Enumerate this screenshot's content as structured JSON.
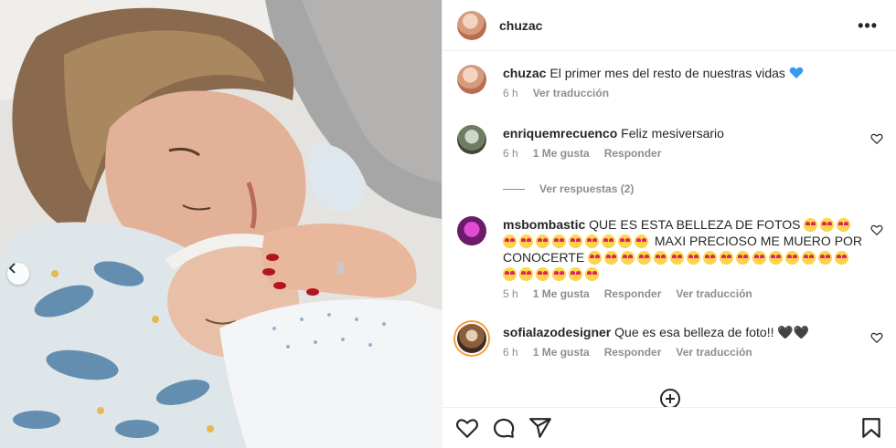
{
  "post": {
    "username": "chuzac",
    "more_label": "•••"
  },
  "caption": {
    "username": "chuzac",
    "text": "El primer mes del resto de nuestras vidas",
    "emoji": "💙",
    "time": "6 h",
    "translate": "Ver traducción"
  },
  "comments": [
    {
      "username": "enriquemrecuenco",
      "text": "Feliz mesiversario",
      "time": "6 h",
      "likes": "1 Me gusta",
      "reply": "Responder"
    },
    {
      "username": "msbombastic",
      "text_a": "QUE ES ESTA BELLEZA DE FOTOS",
      "text_b": "MAXI PRECIOSO ME MUERO POR",
      "text_c": "CONOCERTE",
      "time": "5 h",
      "likes": "1 Me gusta",
      "reply": "Responder",
      "translate": "Ver traducción"
    },
    {
      "username": "sofialazodesigner",
      "text": "Que es esa belleza de foto!!",
      "hearts": "🖤🖤",
      "time": "6 h",
      "likes": "1 Me gusta",
      "reply": "Responder",
      "translate": "Ver traducción"
    }
  ],
  "replies_toggle": "Ver respuestas (2)",
  "colors": {
    "text": "#262626",
    "muted": "#8e8e8e",
    "border": "#efefef",
    "heart_emoji": "#3897f0"
  },
  "icons": [
    "more-icon",
    "heart-icon",
    "comment-icon",
    "share-icon",
    "bookmark-icon",
    "add-circle-icon",
    "chevron-left-icon"
  ]
}
